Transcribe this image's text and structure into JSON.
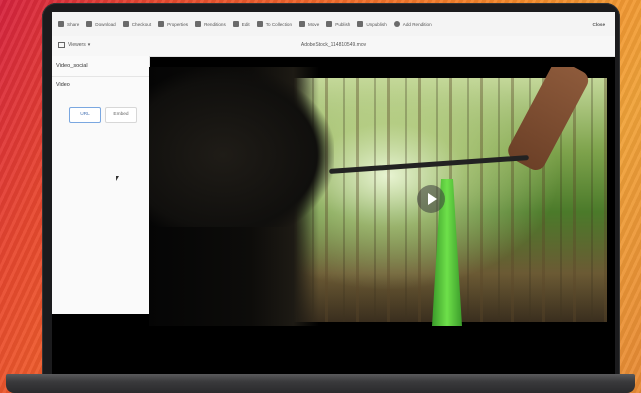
{
  "toolbar": {
    "items": [
      {
        "label": "Share",
        "icon": "share-icon"
      },
      {
        "label": "Download",
        "icon": "download-icon"
      },
      {
        "label": "Checkout",
        "icon": "lock-icon"
      },
      {
        "label": "Properties",
        "icon": "info-icon"
      },
      {
        "label": "Renditions",
        "icon": "renditions-icon"
      },
      {
        "label": "Edit",
        "icon": "pencil-icon"
      },
      {
        "label": "To Collection",
        "icon": "collection-icon"
      },
      {
        "label": "Move",
        "icon": "move-icon"
      },
      {
        "label": "Publish",
        "icon": "publish-icon"
      },
      {
        "label": "Unpublish",
        "icon": "unpublish-icon"
      },
      {
        "label": "Add Rendition",
        "icon": "add-icon"
      }
    ],
    "close_label": "Close"
  },
  "subbar": {
    "viewers_label": "Viewers",
    "filename": "AdobeStock_114810549.mov"
  },
  "panel": {
    "title": "Video_social",
    "subtitle": "Video",
    "url_button": "URL",
    "embed_button": "Embed"
  }
}
